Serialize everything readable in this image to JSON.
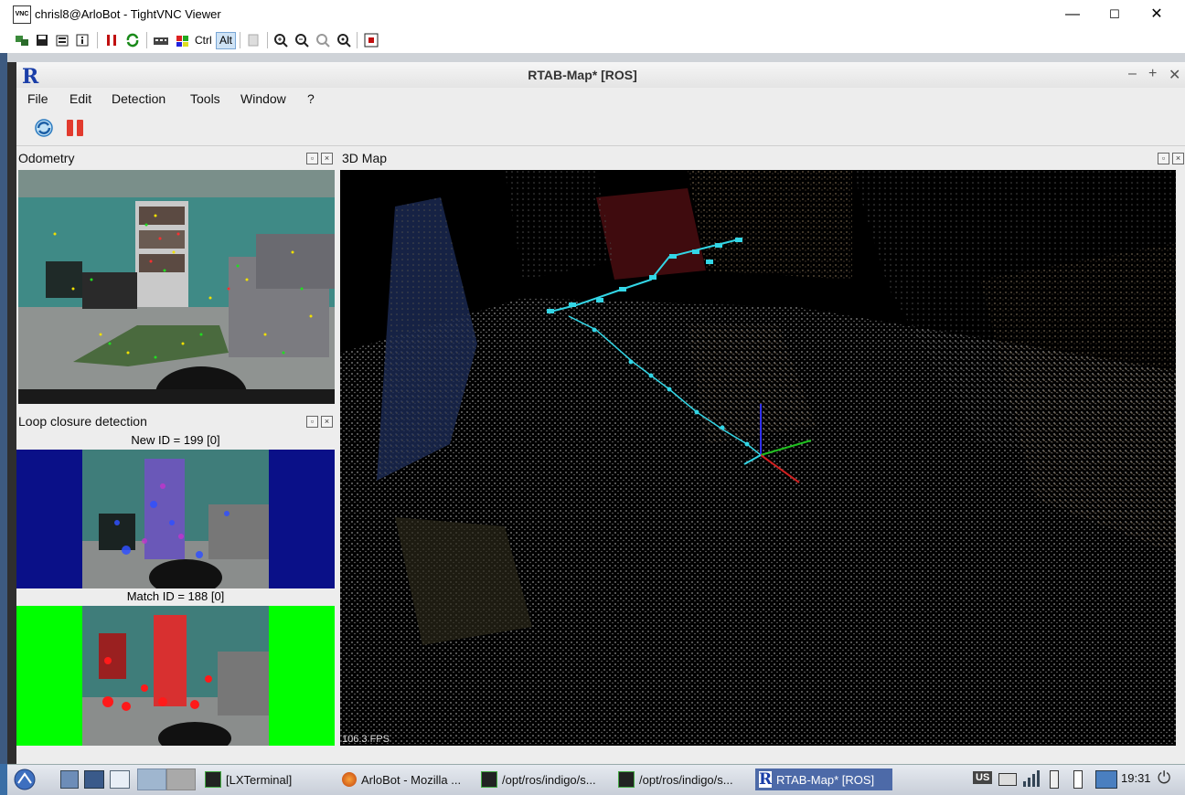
{
  "vnc": {
    "title": "chrisl8@ArloBot - TightVNC Viewer",
    "icon_name": "vnc-app-icon",
    "controls": {
      "minimize": "—",
      "maximize": "☐",
      "close": "✕"
    },
    "toolbar": {
      "ctrl_label": "Ctrl",
      "alt_label": "Alt",
      "items": [
        "new-connection-icon",
        "save-icon",
        "options-icon",
        "info-icon",
        "pause-icon",
        "refresh-icon",
        "send-ctrl-alt-del-icon",
        "send-ctrl-esc-icon",
        "ctrl-key-icon",
        "alt-key-icon",
        "clipboard-icon",
        "zoom-in-icon",
        "zoom-out-icon",
        "zoom-100-icon",
        "zoom-auto-icon",
        "fullscreen-icon"
      ]
    }
  },
  "rtab": {
    "logo": "R",
    "title": "RTAB-Map* [ROS]",
    "controls": {
      "minimize": "–",
      "maximize": "+",
      "close": "✕"
    },
    "menu": [
      "File",
      "Edit",
      "Detection",
      "Tools",
      "Window",
      "?"
    ],
    "toolbar_icons": [
      "reset-icon",
      "pause-icon"
    ],
    "panels": {
      "odometry": {
        "title": "Odometry"
      },
      "loop": {
        "title": "Loop closure detection",
        "new_id": "New ID = 199 [0]",
        "match_id": "Match ID = 188 [0]"
      },
      "map3d": {
        "title": "3D Map",
        "fps": "106.3 FPS"
      }
    },
    "colors": {
      "trajectory": "#33d6e6",
      "new_bg": "#0a1088",
      "match_bg": "#00ff00"
    }
  },
  "taskbar": {
    "items": [
      {
        "label": "[LXTerminal]",
        "icon": "terminal-icon"
      },
      {
        "label": "ArloBot - Mozilla ...",
        "icon": "firefox-icon"
      },
      {
        "label": "/opt/ros/indigo/s...",
        "icon": "terminal-icon"
      },
      {
        "label": "/opt/ros/indigo/s...",
        "icon": "terminal-icon"
      },
      {
        "label": "RTAB-Map* [ROS]",
        "icon": "rtabmap-icon",
        "active": true
      }
    ],
    "keyboard_layout": "US",
    "clock": "19:31"
  }
}
